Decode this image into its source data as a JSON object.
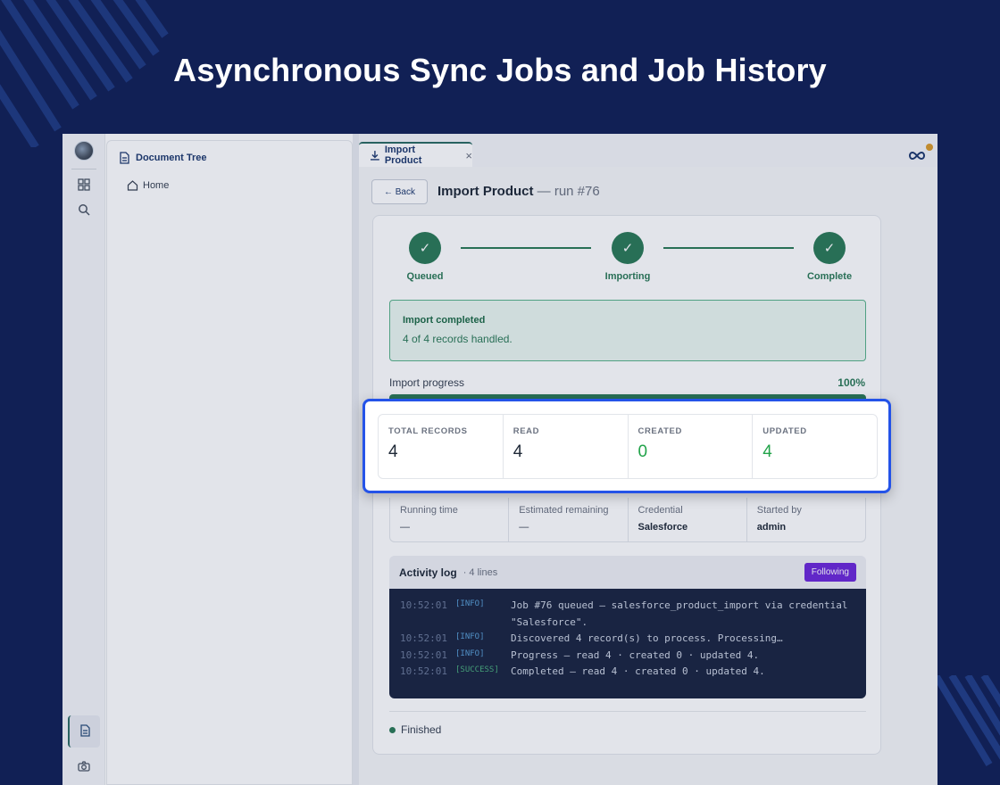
{
  "headline": "Asynchronous Sync Jobs and Job History",
  "colors": {
    "background": "#112055",
    "accent_green": "#2c7a57",
    "highlight_border": "#2453e8",
    "following_button": "#6d28d9"
  },
  "rail": {
    "icons": [
      "avatar",
      "grid-icon",
      "search-icon",
      "document-icon",
      "camera-icon"
    ]
  },
  "doc_tree": {
    "title": "Document Tree",
    "home": "Home"
  },
  "tab": {
    "label": "Import Product",
    "close": "×"
  },
  "back_button": "← Back",
  "page_title": {
    "name": "Import Product",
    "run": "— run #76"
  },
  "steps": [
    {
      "label": "Queued",
      "check": "✓"
    },
    {
      "label": "Importing",
      "check": "✓"
    },
    {
      "label": "Complete",
      "check": "✓"
    }
  ],
  "alert": {
    "title": "Import completed",
    "detail": "4 of 4 records handled."
  },
  "progress": {
    "label": "Import progress",
    "percent_text": "100%",
    "value": 1.0
  },
  "stats": [
    {
      "key": "TOTAL RECORDS",
      "value": "4"
    },
    {
      "key": "READ",
      "value": "4"
    },
    {
      "key": "CREATED",
      "value": "0"
    },
    {
      "key": "UPDATED",
      "value": "4"
    }
  ],
  "meta": [
    {
      "key": "Running time",
      "value": "—"
    },
    {
      "key": "Estimated remaining",
      "value": "—"
    },
    {
      "key": "Credential",
      "value": "Salesforce"
    },
    {
      "key": "Started by",
      "value": "admin"
    }
  ],
  "log": {
    "title": "Activity log",
    "count": "· 4 lines",
    "following": "Following",
    "lines": [
      {
        "ts": "10:52:01",
        "level": "[INFO]",
        "msg": "Job #76 queued — salesforce_product_import via credential \"Salesforce\"."
      },
      {
        "ts": "10:52:01",
        "level": "[INFO]",
        "msg": "Discovered 4 record(s) to process. Processing…"
      },
      {
        "ts": "10:52:01",
        "level": "[INFO]",
        "msg": "Progress — read 4 · created 0 · updated 4."
      },
      {
        "ts": "10:52:01",
        "level": "[SUCCESS]",
        "msg": "Completed — read 4 · created 0 · updated 4."
      }
    ]
  },
  "status": "Finished"
}
